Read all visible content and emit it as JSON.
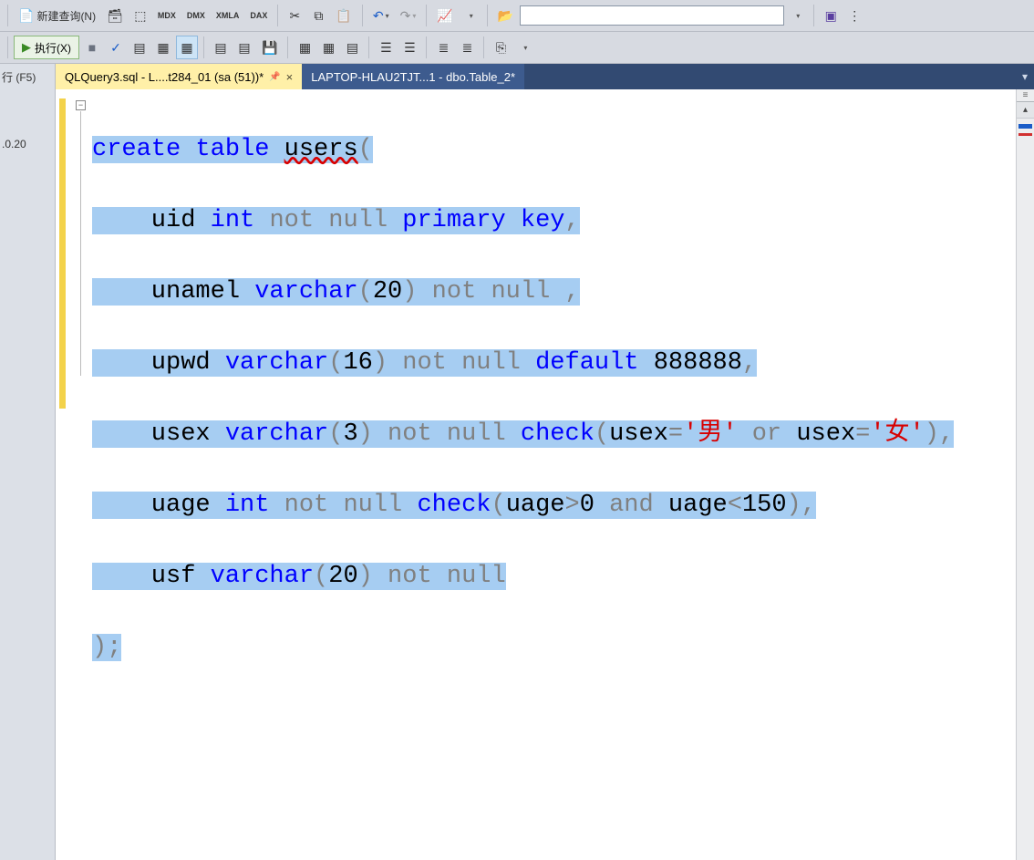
{
  "toolbar1": {
    "new_query_label": "新建查询(N)",
    "mdx_label": "MDX",
    "dmx_label": "DMX",
    "xmla_label": "XMLA",
    "dax_label": "DAX"
  },
  "toolbar2": {
    "execute_label": "执行(X)"
  },
  "left": {
    "run_hint": "行 (F5)",
    "ip_fragment": ".0.20"
  },
  "tabs": {
    "active_label": "QLQuery3.sql - L....t284_01 (sa (51))*",
    "inactive_label": "LAPTOP-HLAU2TJT...1 - dbo.Table_2*"
  },
  "code": {
    "l1_create": "create",
    "l1_table": " table ",
    "l1_users": "users",
    "l1_paren": "(",
    "l2_uid": "    uid ",
    "l2_int": "int ",
    "l2_nn": "not null ",
    "l2_pk": "primary key",
    "comma": ",",
    "l3_uname": "    unamel ",
    "l3_varchar": "varchar",
    "l3_p20o": "(",
    "l3_20": "20",
    "l3_p20c": ")",
    "l3_nn": " not null ",
    "l4_upwd": "    upwd ",
    "l4_varchar": "varchar",
    "l4_po": "(",
    "l4_16": "16",
    "l4_pc": ")",
    "l4_nn": " not null ",
    "l4_def": "default ",
    "l4_888": "888888",
    "l5_usex": "    usex ",
    "l5_varchar": "varchar",
    "l5_po": "(",
    "l5_3": "3",
    "l5_pc": ")",
    "l5_nn": " not null ",
    "l5_check": "check",
    "l5_co": "(",
    "l5_usex1": "usex",
    "l5_eq": "=",
    "l5_m": "'男'",
    "l5_or": " or ",
    "l5_usex2": "usex",
    "l5_eq2": "=",
    "l5_f": "'女'",
    "l5_cc": ")",
    "l6_uage": "    uage ",
    "l6_int": "int ",
    "l6_nn": "not null ",
    "l6_check": "check",
    "l6_co": "(",
    "l6_uage1": "uage",
    "l6_gt": ">",
    "l6_0": "0",
    "l6_and": " and ",
    "l6_uage2": "uage",
    "l6_lt": "<",
    "l6_150": "150",
    "l6_cc": ")",
    "l7_usf": "    usf ",
    "l7_varchar": "varchar",
    "l7_po": "(",
    "l7_20": "20",
    "l7_pc": ")",
    "l7_nn": " not null",
    "l8_close": ");"
  }
}
